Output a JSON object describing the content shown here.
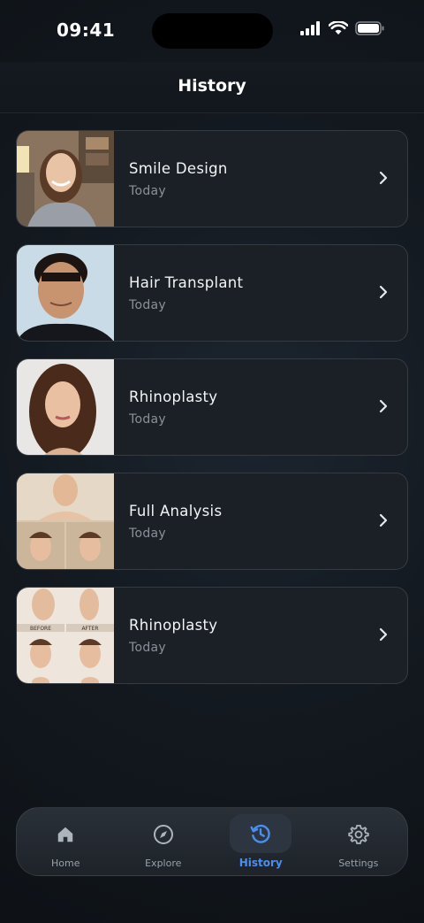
{
  "status_bar": {
    "time": "09:41"
  },
  "header": {
    "title": "History"
  },
  "history": [
    {
      "title": "Smile Design",
      "subtitle": "Today"
    },
    {
      "title": "Hair Transplant",
      "subtitle": "Today"
    },
    {
      "title": "Rhinoplasty",
      "subtitle": "Today"
    },
    {
      "title": "Full Analysis",
      "subtitle": "Today"
    },
    {
      "title": "Rhinoplasty",
      "subtitle": "Today"
    }
  ],
  "thumbnails": {
    "before_label": "BEFORE",
    "after_label": "AFTER"
  },
  "tabbar": {
    "active": "History",
    "tabs": [
      {
        "label": "Home",
        "icon": "home-icon"
      },
      {
        "label": "Explore",
        "icon": "compass-icon"
      },
      {
        "label": "History",
        "icon": "history-icon"
      },
      {
        "label": "Settings",
        "icon": "gear-icon"
      }
    ]
  },
  "colors": {
    "accent": "#4a8ef0",
    "card_bg": "#1b2027",
    "muted_text": "#8a9099"
  }
}
